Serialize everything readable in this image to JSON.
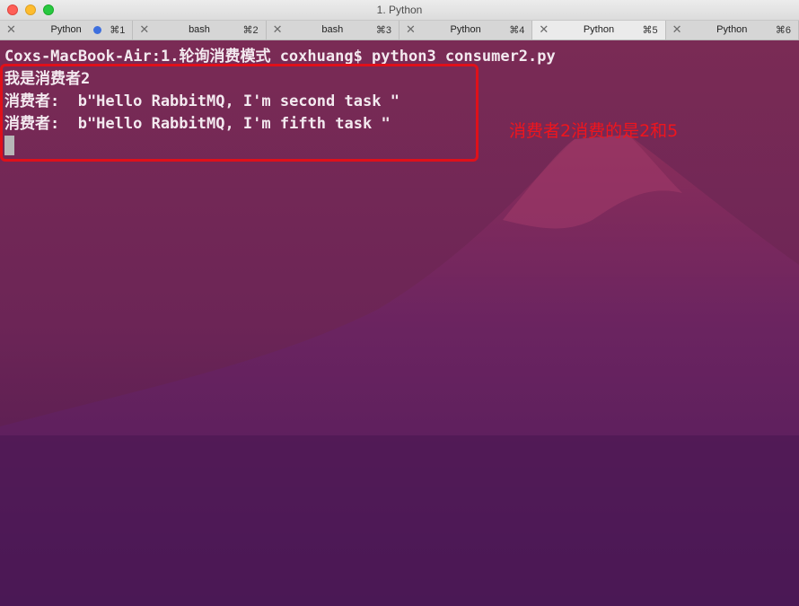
{
  "window": {
    "title": "1. Python"
  },
  "tabs": [
    {
      "label": "Python",
      "shortcut": "⌘1",
      "activity_dot": true,
      "active": false
    },
    {
      "label": "bash",
      "shortcut": "⌘2",
      "active": false
    },
    {
      "label": "bash",
      "shortcut": "⌘3",
      "active": false
    },
    {
      "label": "Python",
      "shortcut": "⌘4",
      "active": false
    },
    {
      "label": "Python",
      "shortcut": "⌘5",
      "active": true
    },
    {
      "label": "Python",
      "shortcut": "⌘6",
      "active": false
    }
  ],
  "terminal": {
    "prompt_line": "Coxs-MacBook-Air:1.轮询消费模式 coxhuang$ python3 consumer2.py",
    "output": [
      "我是消费者2",
      "消费者:  b\"Hello RabbitMQ, I'm second task \"",
      "消费者:  b\"Hello RabbitMQ, I'm fifth task \""
    ]
  },
  "annotation": {
    "text": "消费者2消费的是2和5",
    "color": "#f0151d"
  },
  "colors": {
    "close": "#fe5f57",
    "minimize": "#febc2e",
    "maximize": "#28c840",
    "activity_dot": "#3e6fde",
    "highlight_box": "#e0101a"
  },
  "icons": {
    "tab_close": "close-icon",
    "activity": "activity-dot-icon"
  }
}
